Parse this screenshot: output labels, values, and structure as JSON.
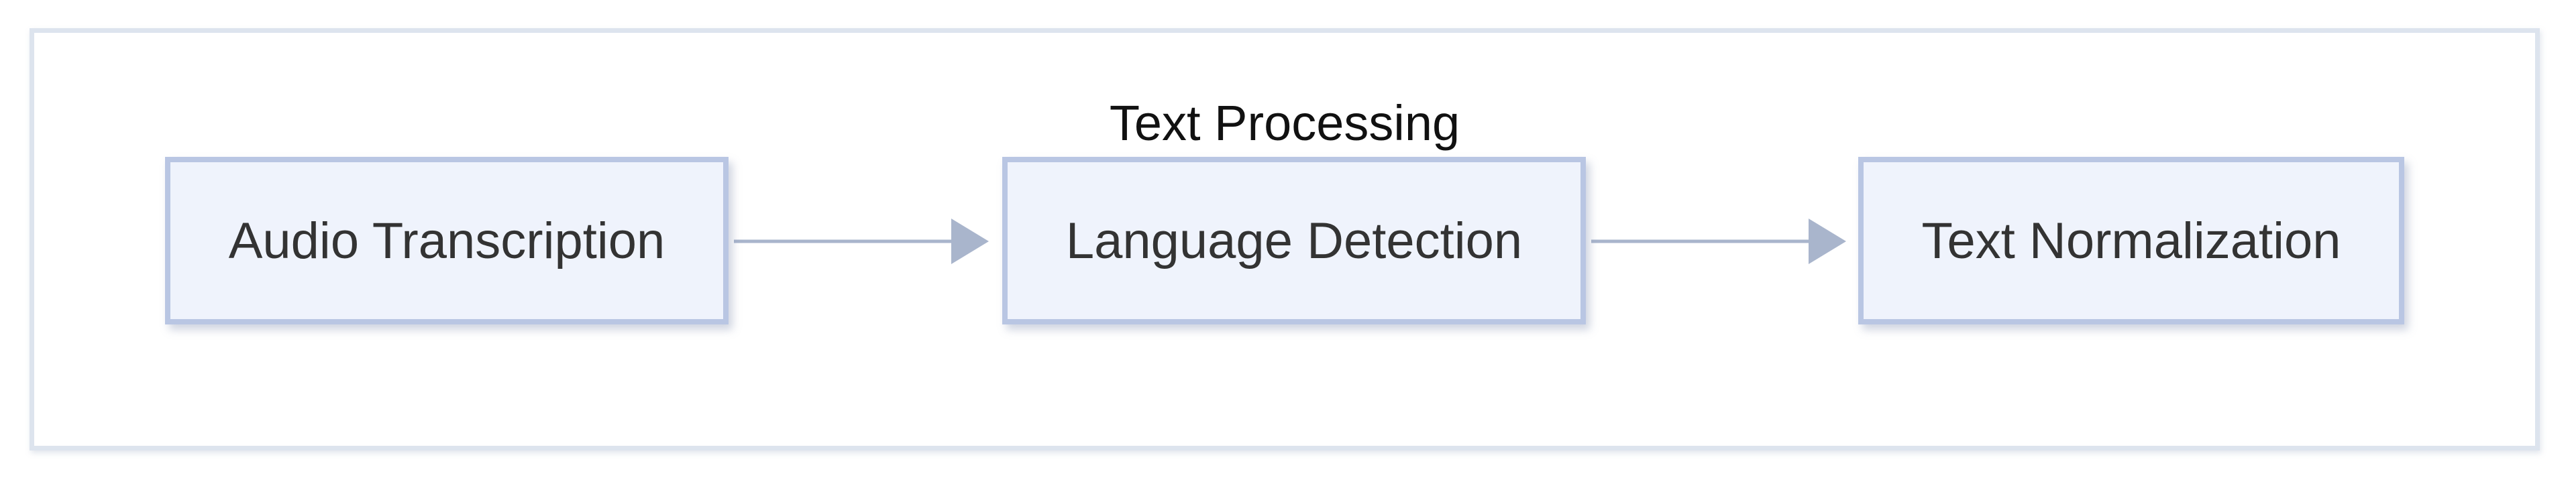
{
  "diagram": {
    "group": {
      "title": "Text Processing"
    },
    "nodes": [
      {
        "id": "audio-transcription",
        "label": "Audio Transcription"
      },
      {
        "id": "language-detection",
        "label": "Language Detection"
      },
      {
        "id": "text-normalization",
        "label": "Text Normalization"
      }
    ],
    "edges": [
      {
        "from": "audio-transcription",
        "to": "language-detection"
      },
      {
        "from": "language-detection",
        "to": "text-normalization"
      }
    ],
    "colors": {
      "node_fill": "#eff3fc",
      "node_border": "#b9c6e3",
      "edge": "#a9b5cc",
      "group_border": "#dde4ee"
    }
  }
}
